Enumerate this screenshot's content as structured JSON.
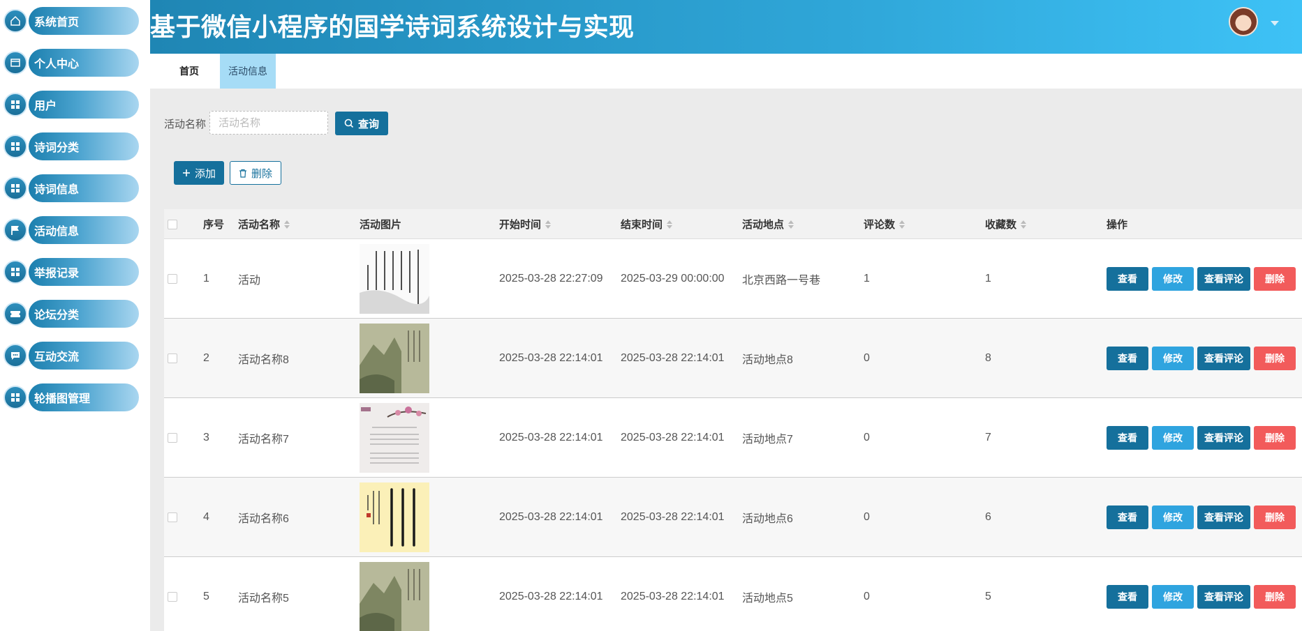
{
  "app": {
    "title": "基于微信小程序的国学诗词系统设计与实现"
  },
  "sidebar": {
    "items": [
      {
        "label": "系统首页",
        "icon": "home-icon"
      },
      {
        "label": "个人中心",
        "icon": "card-icon"
      },
      {
        "label": "用户",
        "icon": "grid-icon"
      },
      {
        "label": "诗词分类",
        "icon": "grid-icon"
      },
      {
        "label": "诗词信息",
        "icon": "grid-icon"
      },
      {
        "label": "活动信息",
        "icon": "flag-icon"
      },
      {
        "label": "举报记录",
        "icon": "grid-icon"
      },
      {
        "label": "论坛分类",
        "icon": "ticket-icon"
      },
      {
        "label": "互动交流",
        "icon": "chat-icon"
      },
      {
        "label": "轮播图管理",
        "icon": "grid-icon"
      }
    ]
  },
  "tabs": {
    "home": "首页",
    "active": "活动信息"
  },
  "search": {
    "label": "活动名称",
    "placeholder": "活动名称",
    "query_label": "查询"
  },
  "toolbar": {
    "add_label": "添加",
    "delete_label": "删除"
  },
  "table": {
    "headers": [
      "序号",
      "活动名称",
      "活动图片",
      "开始时间",
      "结束时间",
      "活动地点",
      "评论数",
      "收藏数",
      "操作"
    ],
    "rows": [
      {
        "index": "1",
        "name": "活动",
        "start": "2025-03-28 22:27:09",
        "end": "2025-03-29 00:00:00",
        "place": "北京西路一号巷",
        "comments": "1",
        "favorites": "1",
        "image": "calligraphy-white"
      },
      {
        "index": "2",
        "name": "活动名称8",
        "start": "2025-03-28 22:14:01",
        "end": "2025-03-28 22:14:01",
        "place": "活动地点8",
        "comments": "0",
        "favorites": "8",
        "image": "landscape-green"
      },
      {
        "index": "3",
        "name": "活动名称7",
        "start": "2025-03-28 22:14:01",
        "end": "2025-03-28 22:14:01",
        "place": "活动地点7",
        "comments": "0",
        "favorites": "7",
        "image": "plum-blossom"
      },
      {
        "index": "4",
        "name": "活动名称6",
        "start": "2025-03-28 22:14:01",
        "end": "2025-03-28 22:14:01",
        "place": "活动地点6",
        "comments": "0",
        "favorites": "6",
        "image": "calligraphy-yellow"
      },
      {
        "index": "5",
        "name": "活动名称5",
        "start": "2025-03-28 22:14:01",
        "end": "2025-03-28 22:14:01",
        "place": "活动地点5",
        "comments": "0",
        "favorites": "5",
        "image": "landscape-green"
      }
    ],
    "actions": {
      "view": "查看",
      "edit": "修改",
      "comment": "查看评论",
      "delete": "删除"
    }
  },
  "colors": {
    "primary": "#15709c",
    "accent": "#2fa4df",
    "danger": "#f25b5b",
    "header_start": "#1f86b4",
    "header_end": "#3ec2f6"
  }
}
